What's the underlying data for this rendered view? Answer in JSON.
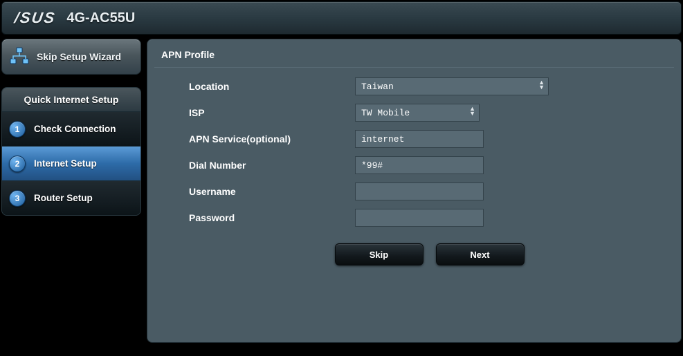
{
  "header": {
    "brand": "/SUS",
    "model": "4G-AC55U"
  },
  "sidebar": {
    "skip_label": "Skip Setup Wizard",
    "qis_title": "Quick Internet Setup",
    "steps": [
      {
        "num": "1",
        "label": "Check Connection",
        "active": false
      },
      {
        "num": "2",
        "label": "Internet Setup",
        "active": true
      },
      {
        "num": "3",
        "label": "Router Setup",
        "active": false
      }
    ]
  },
  "main": {
    "title": "APN Profile",
    "fields": {
      "location_label": "Location",
      "location_value": "Taiwan",
      "isp_label": "ISP",
      "isp_value": "TW Mobile",
      "apn_label": "APN Service(optional)",
      "apn_value": "internet",
      "dial_label": "Dial Number",
      "dial_value": "*99#",
      "username_label": "Username",
      "username_value": "",
      "password_label": "Password",
      "password_value": ""
    },
    "buttons": {
      "skip": "Skip",
      "next": "Next"
    }
  }
}
